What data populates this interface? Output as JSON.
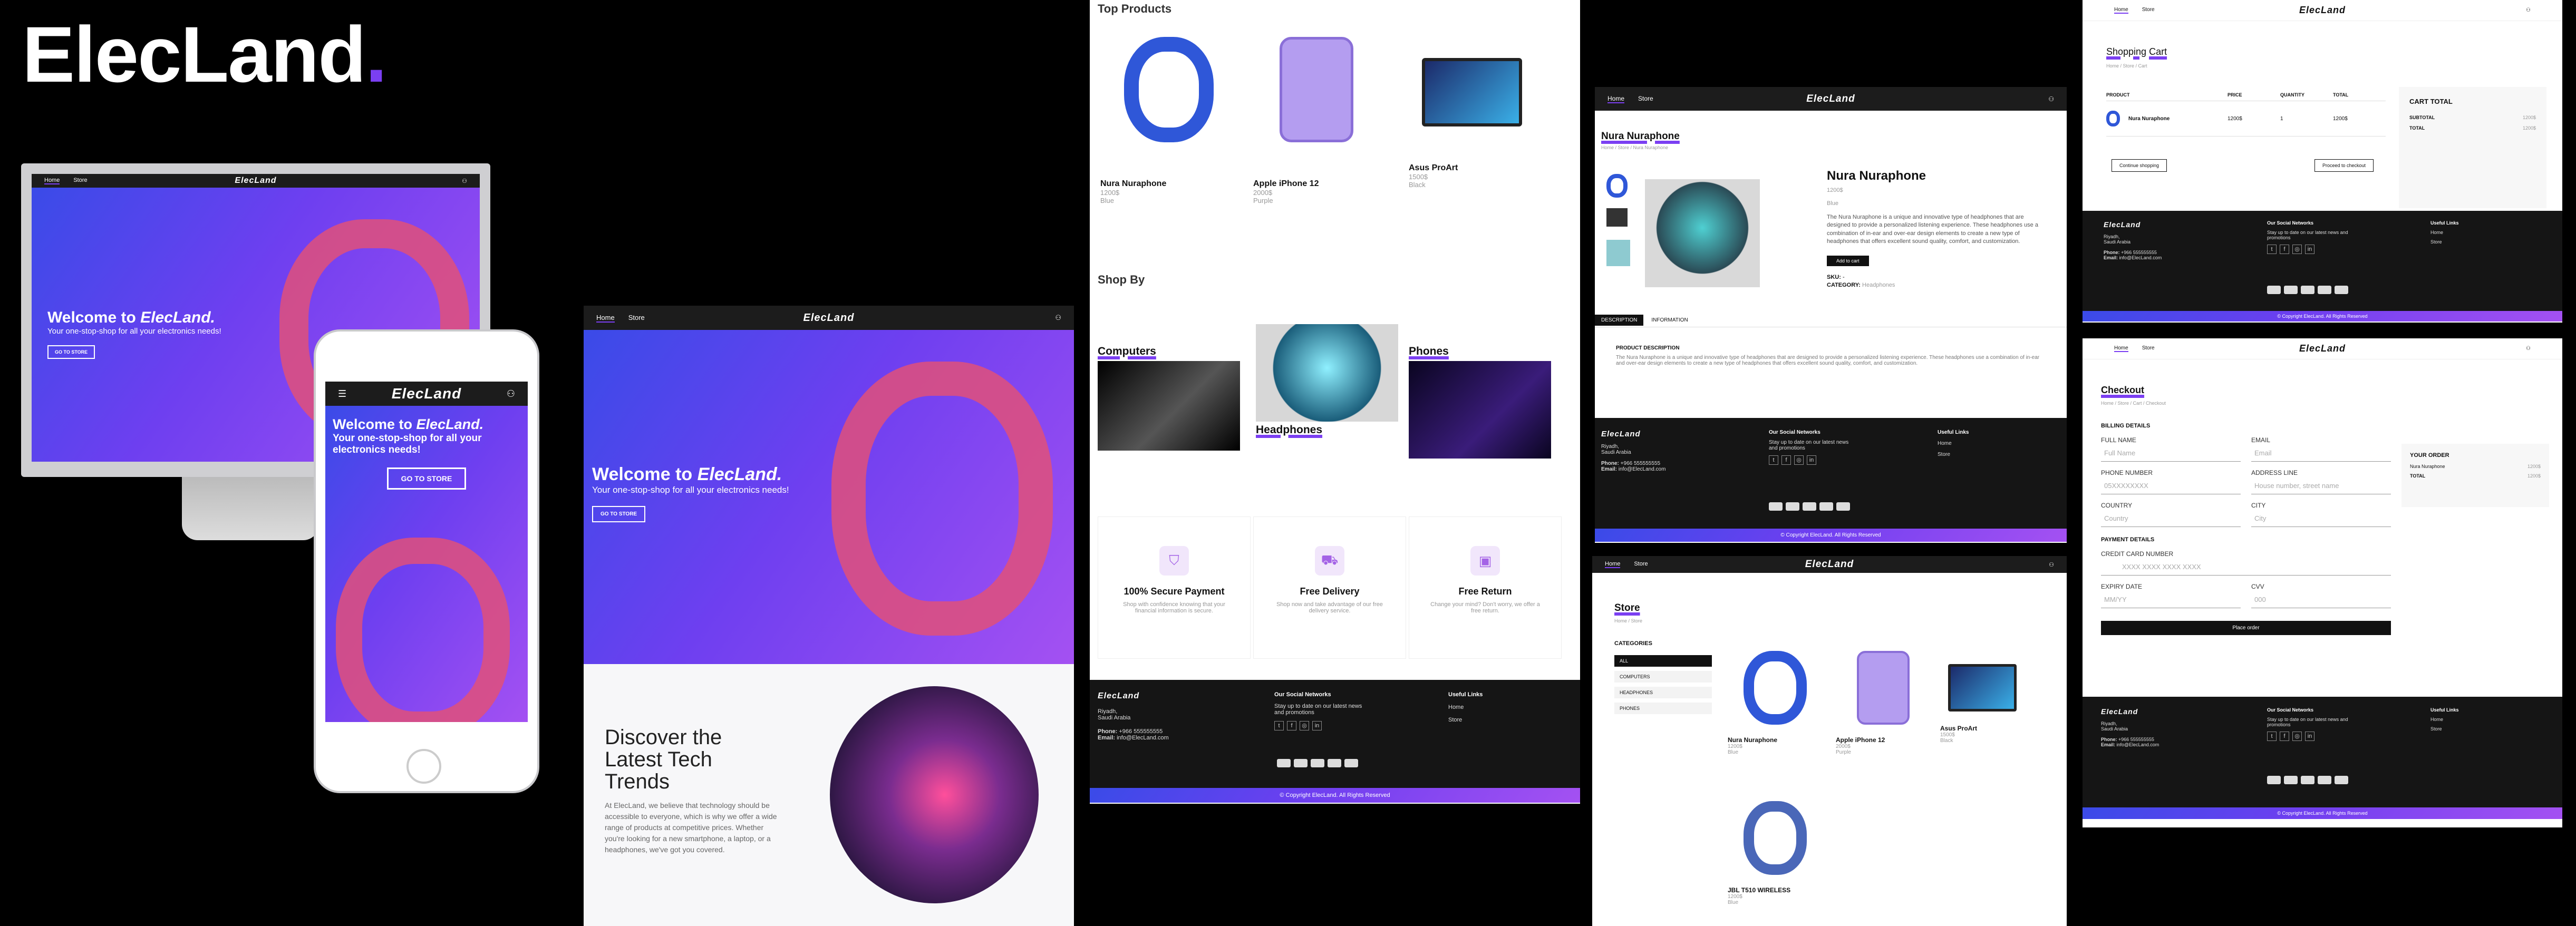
{
  "brand": {
    "name": "ElecLand",
    "dot": ".",
    "accent": "#7b3ff2"
  },
  "nav": {
    "home": "Home",
    "store": "Store",
    "logo": "ElecLand"
  },
  "hero": {
    "title_prefix": "Welcome to ",
    "title_brand": "ElecLand.",
    "subtitle": "Your one-stop-shop for all your electronics needs!",
    "cta": "GO TO STORE",
    "cta_mobile": "GO TO STORE"
  },
  "discover": {
    "title": "Discover the Latest Tech Trends",
    "body": "At ElecLand, we believe that technology should be accessible to everyone, which is why we offer a wide range of products at competitive prices. Whether you're looking for a new smartphone, a laptop, or a headphones, we've got you covered."
  },
  "top_products": {
    "title": "Top Products",
    "items": [
      {
        "name": "Nura Nuraphone",
        "price": "1200$",
        "color": "Blue",
        "icon": "headphones-blue"
      },
      {
        "name": "Apple iPhone 12",
        "price": "2000$",
        "color": "Purple",
        "icon": "iphone-purple"
      },
      {
        "name": "Asus ProArt",
        "price": "1500$",
        "color": "Black",
        "icon": "laptop-black"
      }
    ]
  },
  "shop_by": {
    "title": "Shop By",
    "categories": [
      "Computers",
      "Headphones",
      "Phones"
    ]
  },
  "features": [
    {
      "title": "100% Secure Payment",
      "text": "Shop with confidence knowing that your financial information is secure.",
      "icon": "shield-icon"
    },
    {
      "title": "Free Delivery",
      "text": "Shop now and take advantage of our free delivery service.",
      "icon": "truck-icon"
    },
    {
      "title": "Free Return",
      "text": "Change your mind? Don't worry, we offer a free return.",
      "icon": "box-icon"
    }
  ],
  "footer": {
    "logo": "ElecLand",
    "address1": "Riyadh,",
    "address2": "Saudi Arabia",
    "phone_label": "Phone:",
    "phone": "+966 555555555",
    "email_label": "Email:",
    "email": "info@ElecLand.com",
    "social_title": "Our Social Networks",
    "social_text": "Stay up to date on our latest news and promotions",
    "social_icons": [
      "t",
      "f",
      "◎",
      "in"
    ],
    "links_title": "Useful Links",
    "links": [
      "Home",
      "Store"
    ],
    "copyright": "© Copyright ElecLand. All Rights Reserved"
  },
  "product": {
    "crumb_title": "Nura Nuraphone",
    "crumb": "Home / Store / Nura Nuraphone",
    "name": "Nura Nuraphone",
    "price": "1200$",
    "color": "Blue",
    "desc": "The Nura Nuraphone is a unique and innovative type of headphones that are designed to provide a personalized listening experience. These headphones use a combination of in-ear and over-ear design elements to create a new type of headphones that offers excellent sound quality, comfort, and customization.",
    "add": "Add to cart",
    "sku": "SKU:",
    "sku_val": "-",
    "cat": "CATEGORY:",
    "cat_val": "Headphones",
    "tab1": "DESCRIPTION",
    "tab2": "INFORMATION",
    "tab_title": "PRODUCT DESCRIPTION"
  },
  "store": {
    "title": "Store",
    "crumb": "Home / Store",
    "cat_title": "CATEGORIES",
    "cats": [
      "ALL",
      "COMPUTERS",
      "HEADPHONES",
      "PHONES"
    ],
    "items": [
      {
        "name": "Nura Nuraphone",
        "price": "1200$",
        "color": "Blue"
      },
      {
        "name": "Apple iPhone 12",
        "price": "2000$",
        "color": "Purple"
      },
      {
        "name": "Asus ProArt",
        "price": "1500$",
        "color": "Black"
      },
      {
        "name": "JBL T510 WIRELESS",
        "price": "1200$",
        "color": "Blue"
      }
    ]
  },
  "cart": {
    "title": "Shopping Cart",
    "crumb": "Home / Store / Cart",
    "cols": [
      "PRODUCT",
      "PRICE",
      "QUANTITY",
      "TOTAL"
    ],
    "item": {
      "name": "Nura Nuraphone",
      "price": "1200$",
      "qty": "1",
      "total": "1200$"
    },
    "continue": "Continue shopping",
    "checkout": "Proceed to checkout",
    "total_title": "CART TOTAL",
    "subtotal": "SUBTOTAL",
    "subtotal_val": "1200$",
    "total": "TOTAL",
    "total_val": "1200$"
  },
  "checkout": {
    "title": "Checkout",
    "crumb": "Home / Store / Cart / Checkout",
    "billing": "BILLING DETAILS",
    "full_name": "FULL NAME",
    "full_name_ph": "Full Name",
    "email": "EMAIL",
    "email_ph": "Email",
    "phone": "PHONE NUMBER",
    "phone_ph": "05XXXXXXXX",
    "address": "ADDRESS LINE",
    "address_ph": "House number, street name",
    "country": "COUNTRY",
    "country_ph": "Country",
    "city": "CITY",
    "city_ph": "City",
    "payment": "PAYMENT DETAILS",
    "card": "CREDIT CARD NUMBER",
    "card_ph": "XXXX XXXX XXXX XXXX",
    "expiry": "EXPIRY DATE",
    "expiry_ph": "MM/YY",
    "cvv": "CVV",
    "cvv_ph": "000",
    "place": "Place order",
    "order_title": "YOUR ORDER",
    "order_item": "Nura Nuraphone",
    "order_item_val": "1200$",
    "order_total": "TOTAL",
    "order_total_val": "1200$"
  }
}
